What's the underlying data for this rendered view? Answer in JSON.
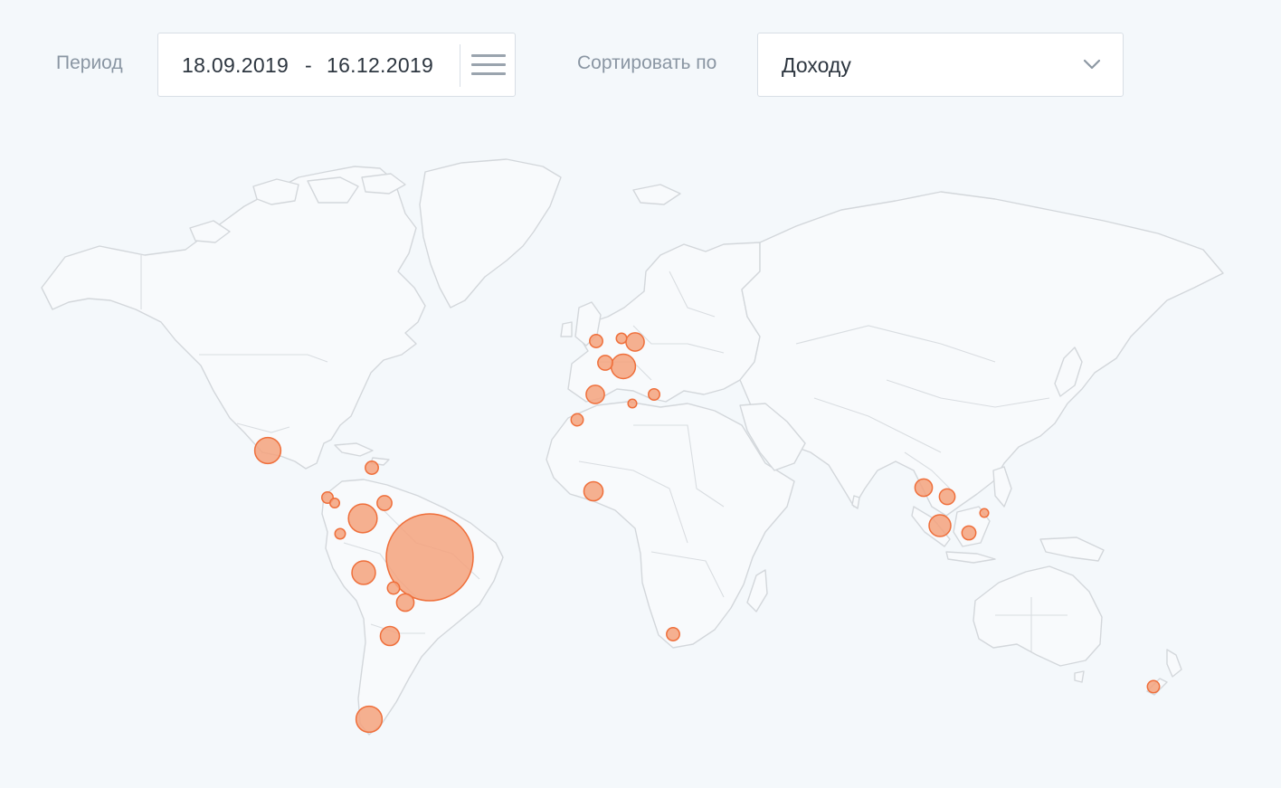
{
  "filters": {
    "period_label": "Период",
    "date_from": "18.09.2019",
    "date_separator": "-",
    "date_to": "16.12.2019",
    "menu_icon": "menu-icon",
    "sort_label": "Сортировать по",
    "sort_value": "Доходу",
    "sort_icon": "chevron-down-icon"
  },
  "colors": {
    "background": "#f4f8fb",
    "land_stroke": "#d3d7db",
    "bubble_fill": "#f5a27c",
    "bubble_stroke": "#ef6f3b"
  },
  "map": {
    "projection": "world",
    "markers": [
      {
        "place": "Brazil",
        "size": 10.0
      },
      {
        "place": "Mexico",
        "size": 3.0
      },
      {
        "place": "Colombia",
        "size": 3.3
      },
      {
        "place": "Peru",
        "size": 2.7
      },
      {
        "place": "Southern Argentina",
        "size": 3.0
      },
      {
        "place": "Chile",
        "size": 2.2
      },
      {
        "place": "Paraguay",
        "size": 2.0
      },
      {
        "place": "Bolivia",
        "size": 1.4
      },
      {
        "place": "Venezuela",
        "size": 1.7
      },
      {
        "place": "Dominican Republic",
        "size": 1.5
      },
      {
        "place": "Costa Rica",
        "size": 1.3
      },
      {
        "place": "Panama",
        "size": 1.1
      },
      {
        "place": "Ecuador",
        "size": 1.2
      },
      {
        "place": "Switzerland",
        "size": 2.8
      },
      {
        "place": "Germany",
        "size": 2.1
      },
      {
        "place": "France",
        "size": 1.7
      },
      {
        "place": "Spain",
        "size": 2.1
      },
      {
        "place": "United Kingdom",
        "size": 1.5
      },
      {
        "place": "Netherlands",
        "size": 1.2
      },
      {
        "place": "Portugal",
        "size": 1.4
      },
      {
        "place": "Italy",
        "size": 1.0
      },
      {
        "place": "Croatia",
        "size": 1.3
      },
      {
        "place": "Ghana",
        "size": 2.2
      },
      {
        "place": "South Africa",
        "size": 1.5
      },
      {
        "place": "Thailand",
        "size": 2.0
      },
      {
        "place": "Vietnam",
        "size": 1.8
      },
      {
        "place": "Singapore",
        "size": 2.5
      },
      {
        "place": "Borneo",
        "size": 1.6
      },
      {
        "place": "Philippines",
        "size": 1.0
      },
      {
        "place": "New Zealand",
        "size": 1.4
      }
    ]
  }
}
